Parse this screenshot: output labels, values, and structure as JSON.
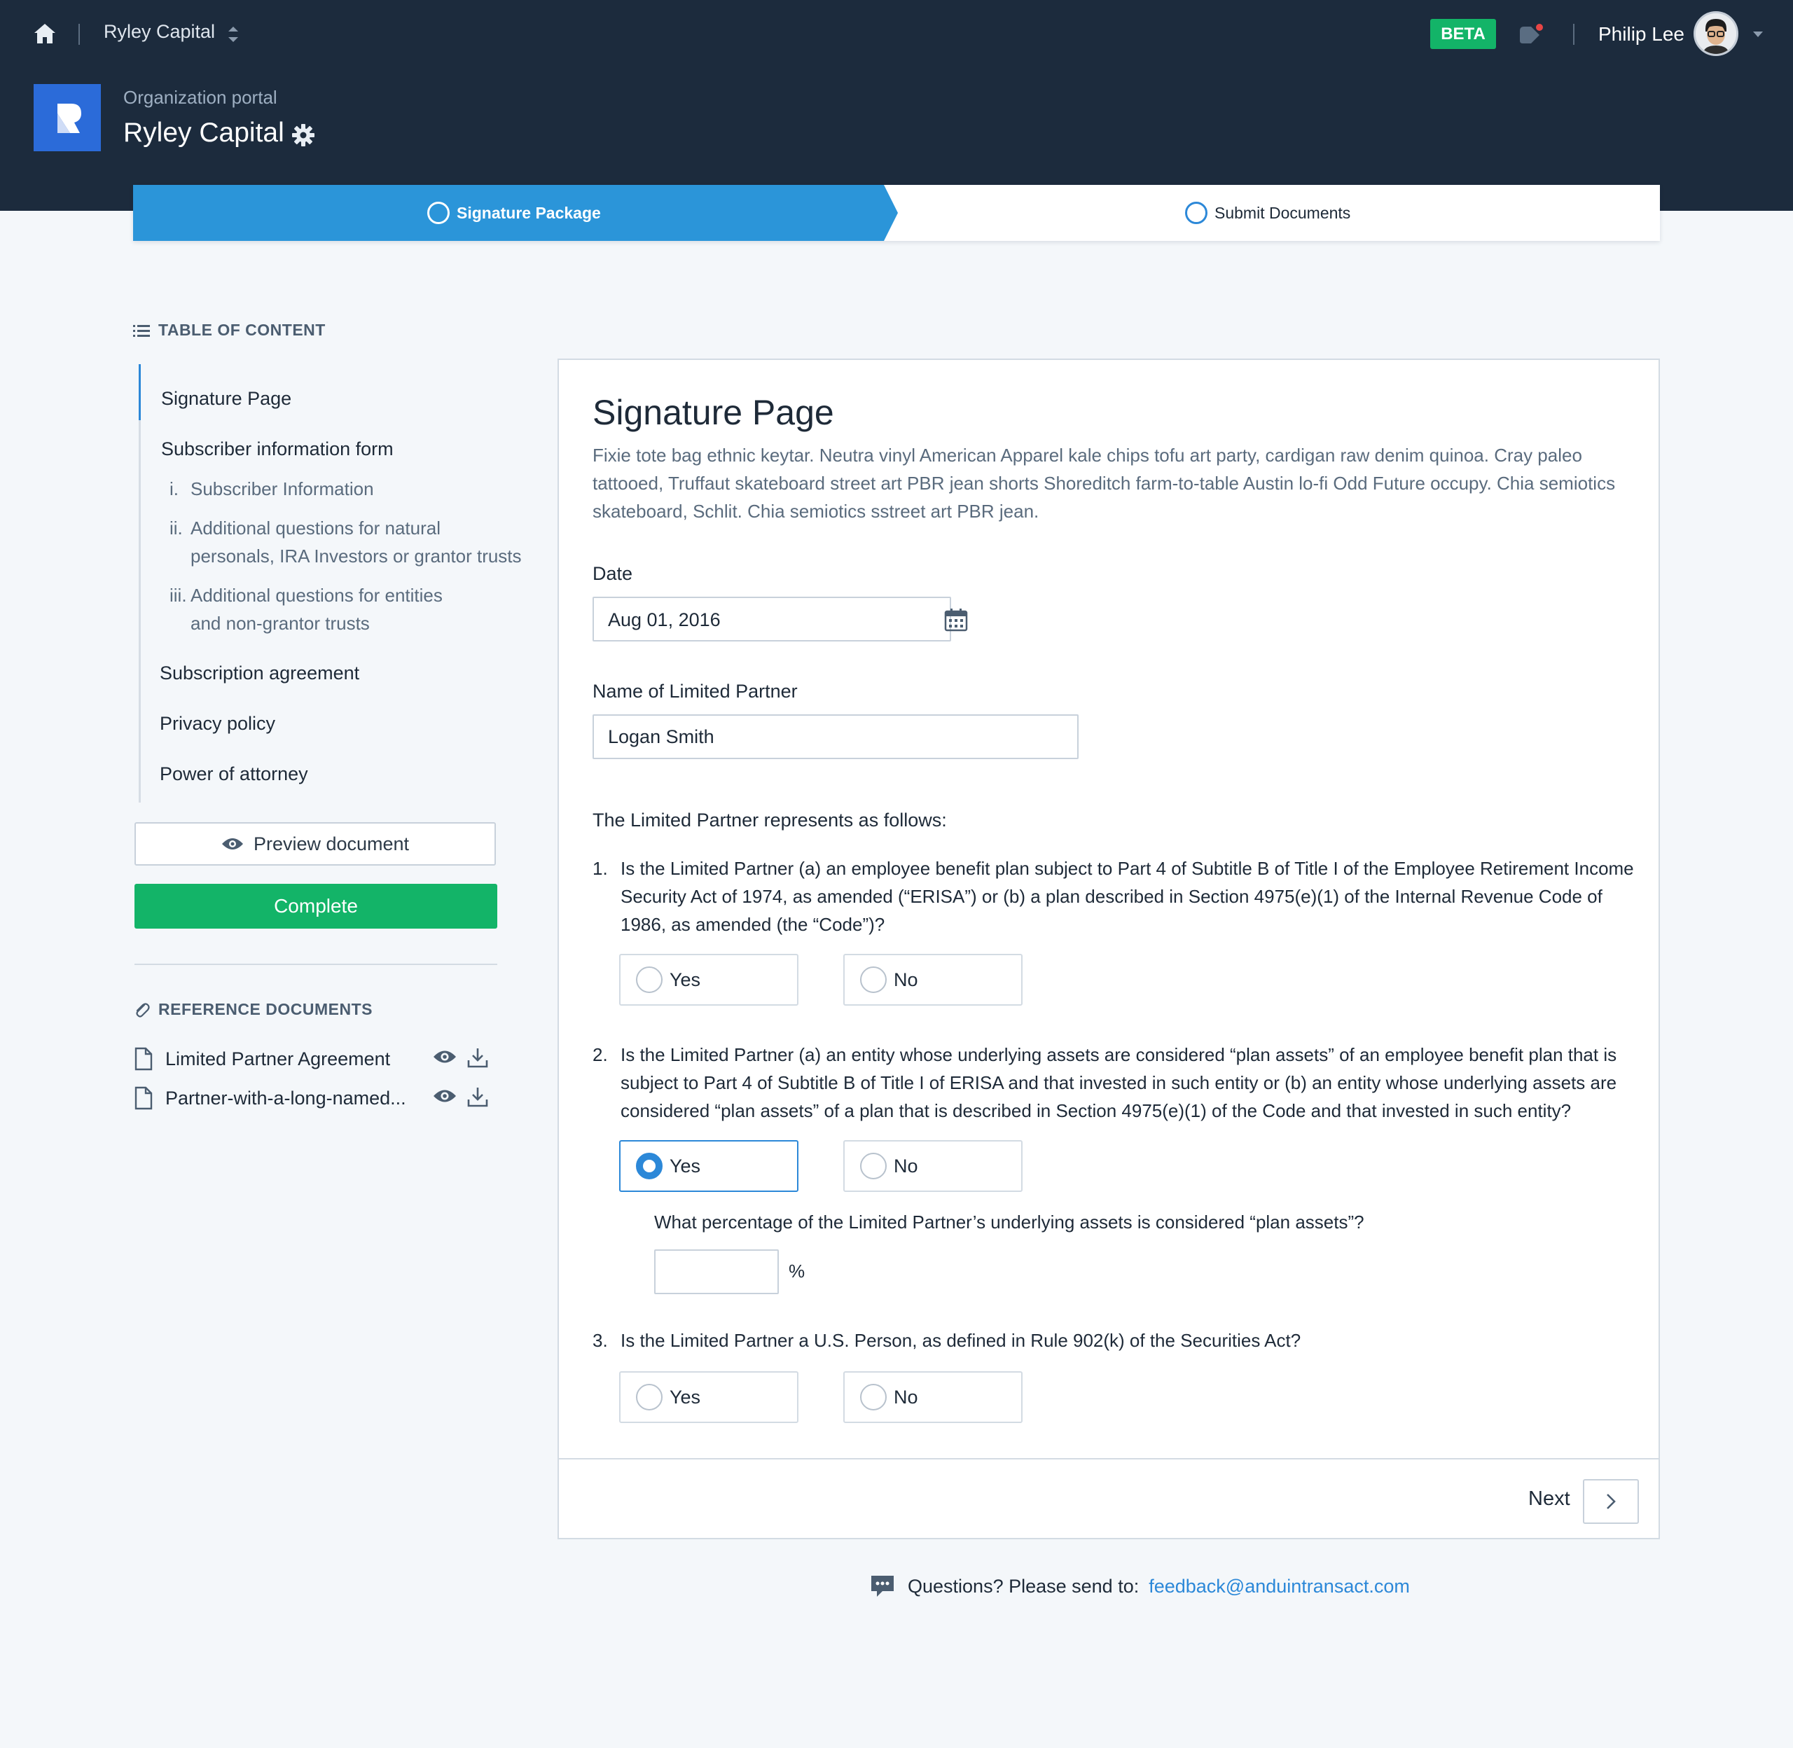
{
  "topbar": {
    "org_switch_label": "Ryley Capital",
    "beta_badge": "BETA",
    "user_name": "Philip Lee"
  },
  "org": {
    "portal_label": "Organization portal",
    "title": "Ryley Capital"
  },
  "stepper": {
    "steps": [
      {
        "label": "Signature Package",
        "active": true
      },
      {
        "label": "Submit Documents",
        "active": false
      }
    ],
    "active_color": "#2b95d9"
  },
  "toc": {
    "heading": "TABLE OF CONTENT",
    "items": [
      {
        "label": "Signature Page"
      },
      {
        "label": "Subscriber information form"
      },
      {
        "label": "Subscription agreement"
      },
      {
        "label": "Privacy policy"
      },
      {
        "label": "Power of attorney"
      }
    ],
    "subitems": [
      {
        "num": "i.",
        "line1": "Subscriber Information",
        "line2": ""
      },
      {
        "num": "ii.",
        "line1": "Additional questions for natural",
        "line2": "personals, IRA Investors or grantor trusts"
      },
      {
        "num": "iii.",
        "line1": "Additional questions for entities",
        "line2": "and non-grantor trusts"
      }
    ]
  },
  "actions": {
    "preview_label": "Preview document",
    "complete_label": "Complete"
  },
  "reference_docs": {
    "heading": "REFERENCE DOCUMENTS",
    "items": [
      {
        "name": "Limited Partner Agreement"
      },
      {
        "name": "Partner-with-a-long-named..."
      }
    ]
  },
  "form": {
    "title": "Signature Page",
    "description": "Fixie tote bag ethnic keytar. Neutra vinyl American Apparel kale chips tofu art party, cardigan raw denim quinoa. Cray paleo tattooed, Truffaut skateboard street art PBR jean shorts Shoreditch farm-to-table Austin lo-fi Odd Future occupy. Chia semiotics skateboard, Schlit. Chia semiotics sstreet art PBR jean.",
    "date_label": "Date",
    "date_value": "Aug 01, 2016",
    "lp_name_label": "Name of Limited Partner",
    "lp_name_value": "Logan Smith",
    "represents_label": "The Limited Partner represents as follows:",
    "questions": [
      {
        "num": "1.",
        "text": "Is the Limited Partner (a) an employee benefit plan subject to Part 4 of Subtitle B of Title I of the Employee Retirement Income Security Act of 1974, as amended (“ERISA”) or (b) a plan described in Section 4975(e)(1) of the Internal Revenue Code of 1986, as amended (the “Code”)?",
        "yes": "Yes",
        "no": "No",
        "selected": null
      },
      {
        "num": "2.",
        "text": "Is the Limited Partner (a) an entity whose underlying assets are considered “plan assets” of an employee benefit plan that is subject to Part 4 of Subtitle B of Title I of ERISA and that invested in such entity or (b) an entity whose underlying assets are considered “plan assets” of a plan that is described in Section 4975(e)(1) of the Code and that invested in such entity?",
        "yes": "Yes",
        "no": "No",
        "selected": "Yes",
        "followup": "What percentage of the Limited Partner’s underlying assets is considered “plan assets”?",
        "followup_value": "",
        "unit": "%"
      },
      {
        "num": "3.",
        "text": "Is the Limited Partner a U.S. Person, as defined in Rule 902(k) of the Securities Act?",
        "yes": "Yes",
        "no": "No",
        "selected": null
      }
    ],
    "next_label": "Next"
  },
  "footer": {
    "question_text": "Questions? Please send to:",
    "email": "feedback@anduintransact.com"
  },
  "colors": {
    "header_bg": "#1c2b3d",
    "accent_blue": "#2c88d8",
    "success_green": "#13b468"
  },
  "icons": [
    "home-icon",
    "updown-chevron-icon",
    "bell-icon",
    "caret-down-icon",
    "gear-icon",
    "list-icon",
    "eye-icon",
    "paperclip-icon",
    "document-icon",
    "download-icon",
    "calendar-icon",
    "chevron-right-icon",
    "chat-icon"
  ]
}
